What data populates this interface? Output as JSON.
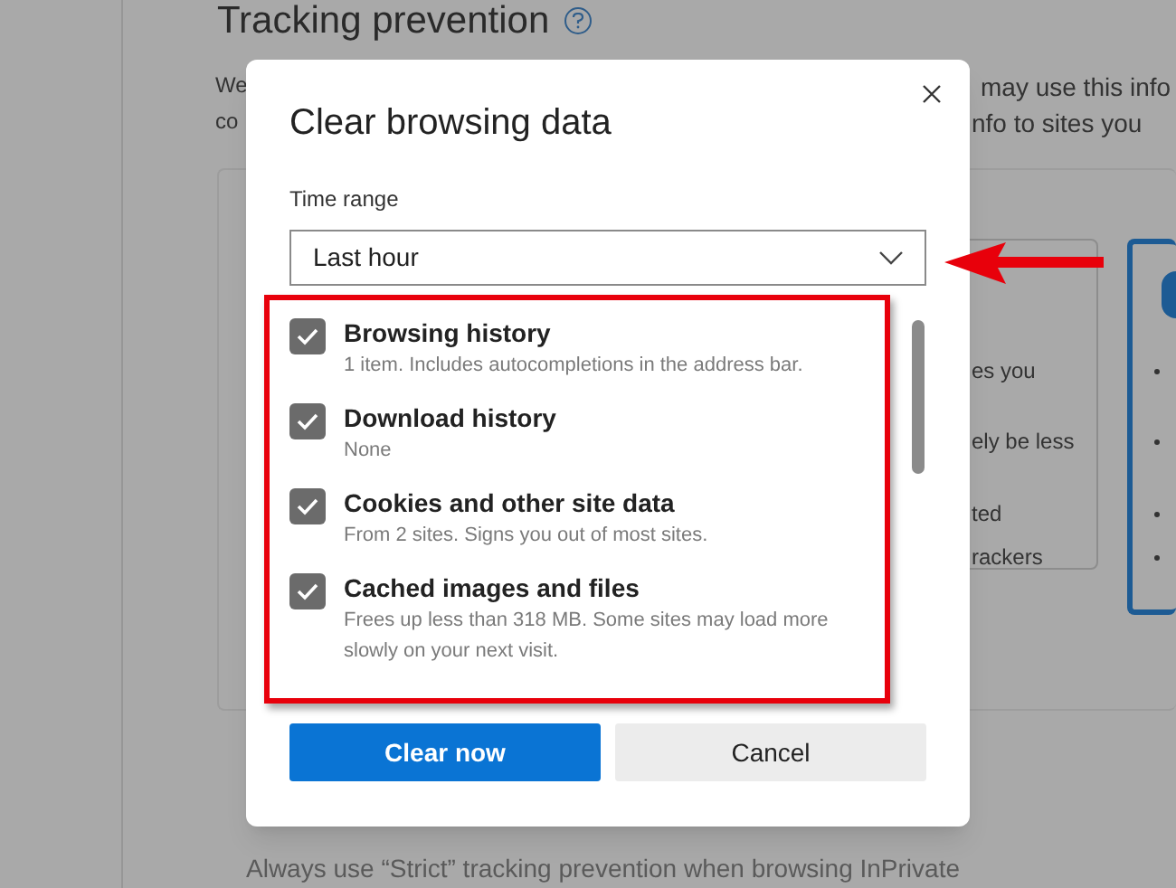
{
  "background": {
    "heading": "Tracking prevention",
    "intro_left": [
      "We",
      "co"
    ],
    "intro_right": [
      "may use this info",
      "nfo to sites you"
    ],
    "card_fragments": [
      "es you",
      "ely be less",
      "ted",
      "rackers"
    ],
    "footer_text": "Always use “Strict” tracking prevention when browsing InPrivate"
  },
  "dialog": {
    "title": "Clear browsing data",
    "time_range": {
      "label": "Time range",
      "value": "Last hour"
    },
    "items": [
      {
        "label": "Browsing history",
        "description": "1 item. Includes autocompletions in the address bar.",
        "checked": true
      },
      {
        "label": "Download history",
        "description": "None",
        "checked": true
      },
      {
        "label": "Cookies and other site data",
        "description": "From 2 sites. Signs you out of most sites.",
        "checked": true
      },
      {
        "label": "Cached images and files",
        "description": "Frees up less than 318 MB. Some sites may load more slowly on your next visit.",
        "checked": true
      }
    ],
    "buttons": [
      {
        "label": "Clear now",
        "kind": "primary"
      },
      {
        "label": "Cancel",
        "kind": "secondary"
      }
    ]
  }
}
